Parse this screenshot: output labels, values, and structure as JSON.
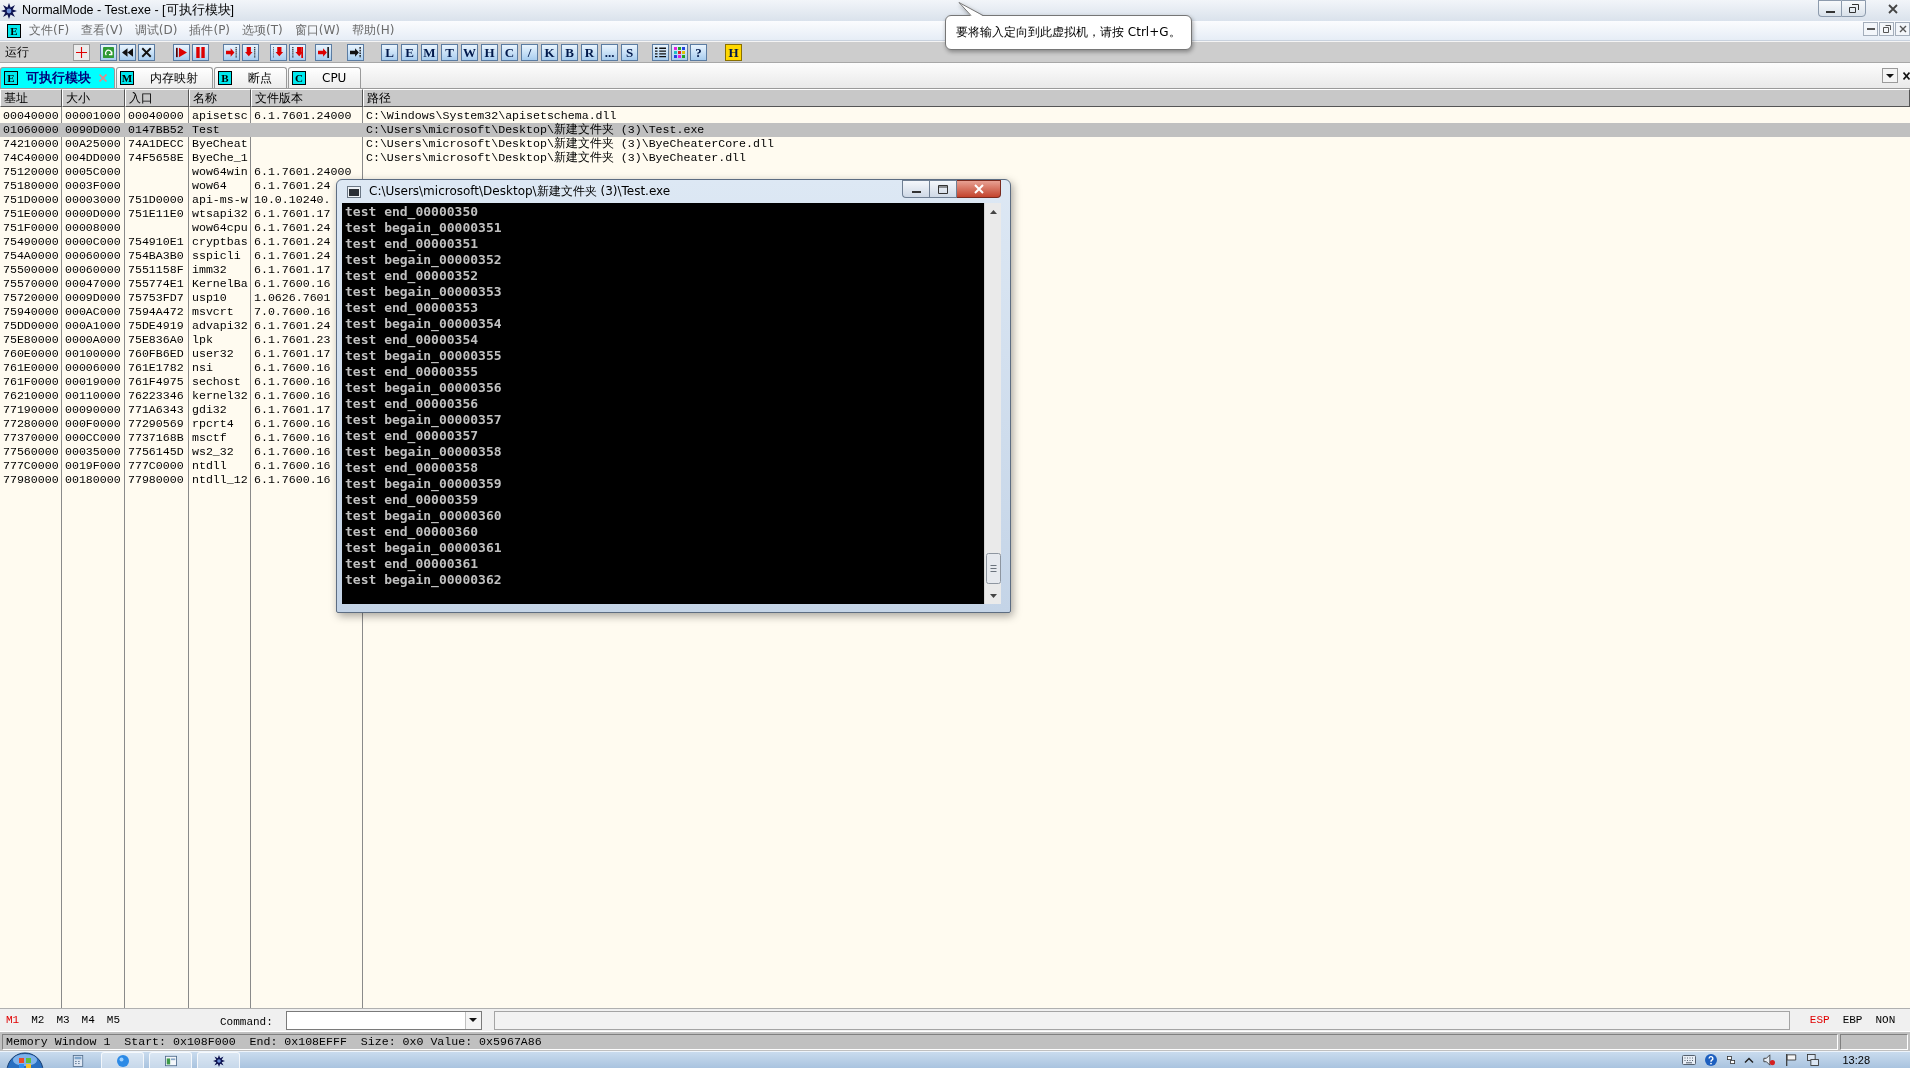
{
  "window": {
    "title": "NormalMode - Test.exe - [可执行模块]"
  },
  "menu": {
    "badge": "E",
    "items": [
      "文件(F)",
      "查看(V)",
      "调试(D)",
      "插件(P)",
      "选项(T)",
      "窗口(W)",
      "帮助(H)"
    ]
  },
  "toolbar": {
    "status": "运行",
    "letter_buttons": [
      "L",
      "E",
      "M",
      "T",
      "W",
      "H",
      "C",
      "/",
      "K",
      "B",
      "R",
      "...",
      "S"
    ],
    "end_buttons": [
      {
        "label": "?",
        "kind": "plain"
      },
      {
        "label": "H",
        "kind": "highlight"
      }
    ]
  },
  "tooltip": {
    "text": "要将输入定向到此虚拟机，请按 Ctrl+G。"
  },
  "tabs": [
    {
      "badge": "E",
      "label": "可执行模块",
      "selected": true,
      "closable": true
    },
    {
      "badge": "M",
      "label": "内存映射",
      "selected": false,
      "closable": false
    },
    {
      "badge": "B",
      "label": "断点",
      "selected": false,
      "closable": false
    },
    {
      "badge": "C",
      "label": "CPU",
      "selected": false,
      "closable": false
    }
  ],
  "table": {
    "columns": [
      "基址",
      "大小",
      "入口",
      "名称",
      "文件版本",
      "路径"
    ],
    "rows": [
      {
        "base": "00040000",
        "size": "00001000",
        "entry": "00040000",
        "name": "apisetsc",
        "version": "6.1.7601.24000",
        "path": "C:\\Windows\\System32\\apisetschema.dll",
        "selected": false
      },
      {
        "base": "01060000",
        "size": "0090D000",
        "entry": "0147BB52",
        "name": "Test",
        "path": "C:\\Users\\microsoft\\Desktop\\新建文件夹 (3)\\Test.exe",
        "selected": true
      },
      {
        "base": "74210000",
        "size": "00A25000",
        "entry": "74A1DECC",
        "name": "ByeCheat",
        "path": "C:\\Users\\microsoft\\Desktop\\新建文件夹 (3)\\ByeCheaterCore.dll",
        "selected": false
      },
      {
        "base": "74C40000",
        "size": "004DD000",
        "entry": "74F5658E",
        "name": "ByeChe_1",
        "path": "C:\\Users\\microsoft\\Desktop\\新建文件夹 (3)\\ByeCheater.dll",
        "selected": false
      },
      {
        "base": "75120000",
        "size": "0005C000",
        "name": "wow64win",
        "version": "6.1.7601.24000",
        "selected": false
      },
      {
        "base": "75180000",
        "size": "0003F000",
        "name": "wow64",
        "version": "6.1.7601.24",
        "selected": false
      },
      {
        "base": "751D0000",
        "size": "00003000",
        "entry": "751D0000",
        "name": "api-ms-w",
        "version": "10.0.10240.",
        "selected": false
      },
      {
        "base": "751E0000",
        "size": "0000D000",
        "entry": "751E11E0",
        "name": "wtsapi32",
        "version": "6.1.7601.17",
        "selected": false
      },
      {
        "base": "751F0000",
        "size": "00008000",
        "name": "wow64cpu",
        "version": "6.1.7601.24",
        "selected": false
      },
      {
        "base": "75490000",
        "size": "0000C000",
        "entry": "754910E1",
        "name": "cryptbas",
        "version": "6.1.7601.24",
        "selected": false
      },
      {
        "base": "754A0000",
        "size": "00060000",
        "entry": "754BA3B0",
        "name": "sspicli",
        "version": "6.1.7601.24",
        "selected": false
      },
      {
        "base": "75500000",
        "size": "00060000",
        "entry": "7551158F",
        "name": "imm32",
        "version": "6.1.7601.17",
        "selected": false
      },
      {
        "base": "75570000",
        "size": "00047000",
        "entry": "755774E1",
        "name": "KernelBa",
        "version": "6.1.7600.16",
        "selected": false
      },
      {
        "base": "75720000",
        "size": "0009D000",
        "entry": "75753FD7",
        "name": "usp10",
        "version": "1.0626.7601",
        "selected": false
      },
      {
        "base": "75940000",
        "size": "000AC000",
        "entry": "7594A472",
        "name": "msvcrt",
        "version": "7.0.7600.16",
        "selected": false
      },
      {
        "base": "75DD0000",
        "size": "000A1000",
        "entry": "75DE4919",
        "name": "advapi32",
        "version": "6.1.7601.24",
        "selected": false
      },
      {
        "base": "75E80000",
        "size": "0000A000",
        "entry": "75E836A0",
        "name": "lpk",
        "version": "6.1.7601.23",
        "selected": false
      },
      {
        "base": "760E0000",
        "size": "00100000",
        "entry": "760FB6ED",
        "name": "user32",
        "version": "6.1.7601.17",
        "selected": false
      },
      {
        "base": "761E0000",
        "size": "00006000",
        "entry": "761E1782",
        "name": "nsi",
        "version": "6.1.7600.16",
        "selected": false
      },
      {
        "base": "761F0000",
        "size": "00019000",
        "entry": "761F4975",
        "name": "sechost",
        "version": "6.1.7600.16",
        "selected": false
      },
      {
        "base": "76210000",
        "size": "00110000",
        "entry": "76223346",
        "name": "kernel32",
        "version": "6.1.7600.16",
        "selected": false
      },
      {
        "base": "77190000",
        "size": "00090000",
        "entry": "771A6343",
        "name": "gdi32",
        "version": "6.1.7601.17",
        "selected": false
      },
      {
        "base": "77280000",
        "size": "000F0000",
        "entry": "77290569",
        "name": "rpcrt4",
        "version": "6.1.7600.16",
        "selected": false
      },
      {
        "base": "77370000",
        "size": "000CC000",
        "entry": "7737168B",
        "name": "msctf",
        "version": "6.1.7600.16",
        "selected": false
      },
      {
        "base": "77560000",
        "size": "00035000",
        "entry": "7756145D",
        "name": "ws2_32",
        "version": "6.1.7600.16",
        "selected": false
      },
      {
        "base": "777C0000",
        "size": "0019F000",
        "entry": "777C0000",
        "name": "ntdll",
        "version": "6.1.7600.16",
        "selected": false
      },
      {
        "base": "77980000",
        "size": "00180000",
        "entry": "77980000",
        "name": "ntdll_12",
        "version": "6.1.7600.16",
        "selected": false
      }
    ]
  },
  "console": {
    "title": "C:\\Users\\microsoft\\Desktop\\新建文件夹 (3)\\Test.exe",
    "lines": [
      "test end_00000350",
      "test begain_00000351",
      "test end_00000351",
      "test begain_00000352",
      "test end_00000352",
      "test begain_00000353",
      "test end_00000353",
      "test begain_00000354",
      "test end_00000354",
      "test begain_00000355",
      "test end_00000355",
      "test begain_00000356",
      "test end_00000356",
      "test begain_00000357",
      "test end_00000357",
      "test begain_00000358",
      "test end_00000358",
      "test begain_00000359",
      "test end_00000359",
      "test begain_00000360",
      "test end_00000360",
      "test begain_00000361",
      "test end_00000361",
      "test begain_00000362"
    ]
  },
  "command_bar": {
    "memory_tabs": [
      {
        "label": "M1",
        "selected": true
      },
      {
        "label": "M2",
        "selected": false
      },
      {
        "label": "M3",
        "selected": false
      },
      {
        "label": "M4",
        "selected": false
      },
      {
        "label": "M5",
        "selected": false
      }
    ],
    "command_label": "Command:",
    "registers": [
      {
        "label": "ESP",
        "selected": true
      },
      {
        "label": "EBP",
        "selected": false
      },
      {
        "label": "NON",
        "selected": false
      }
    ]
  },
  "status_bar": {
    "text": "Memory Window 1  Start: 0x108F000  End: 0x108EFFF  Size: 0x0 Value: 0x5967A86"
  },
  "taskbar": {
    "clock": "13:28"
  }
}
